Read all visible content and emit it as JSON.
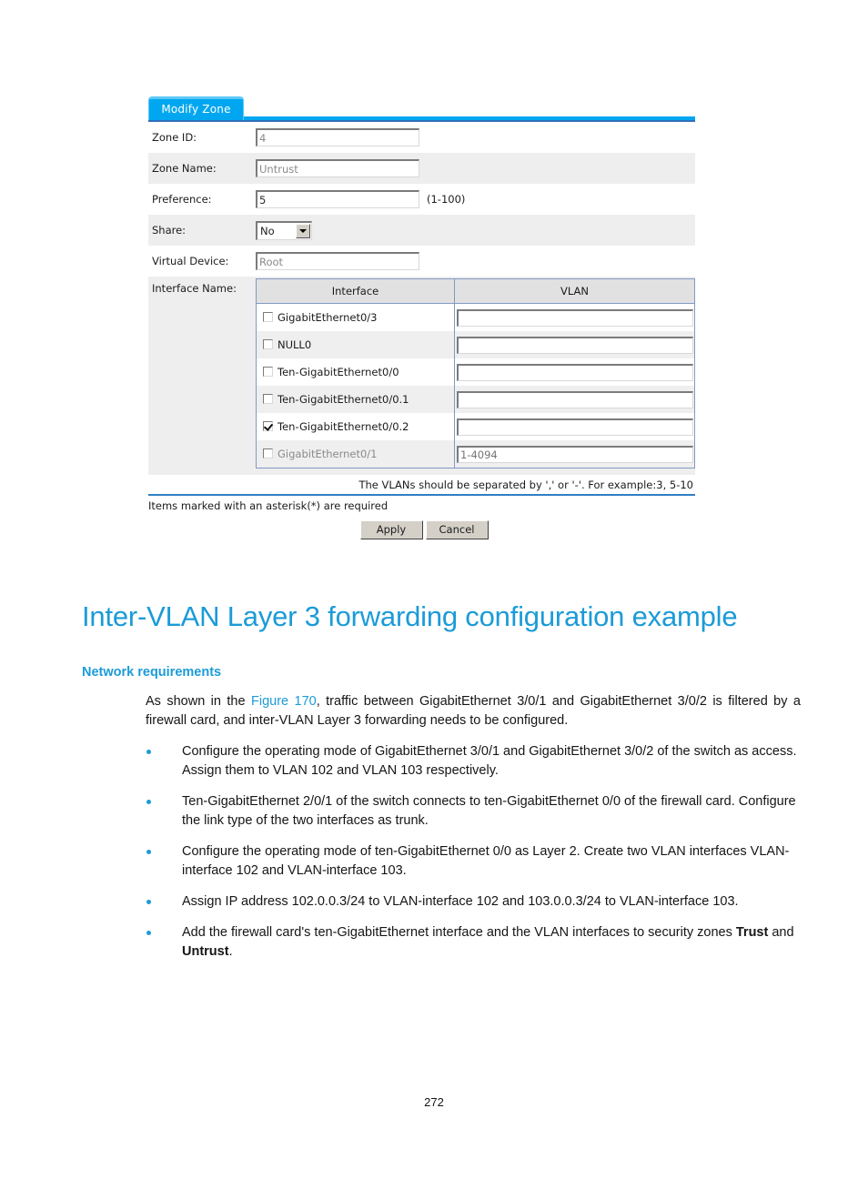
{
  "screenshot": {
    "tab_label": "Modify Zone",
    "fields": [
      {
        "label": "Zone ID:",
        "value": "4",
        "dim": true
      },
      {
        "label": "Zone Name:",
        "value": "Untrust",
        "dim": true
      },
      {
        "label": "Preference:",
        "value": "5",
        "dim": false,
        "hint": "(1-100)"
      },
      {
        "label": "Share:",
        "value": "No",
        "control": "select"
      },
      {
        "label": "Virtual Device:",
        "value": "Root",
        "dim": true
      }
    ],
    "interface_section": {
      "label": "Interface Name:",
      "columns": [
        "Interface",
        "VLAN"
      ],
      "rows": [
        {
          "name": "GigabitEthernet0/3",
          "checked": false,
          "vlan": "",
          "vlan_placeholder": "",
          "dim": false
        },
        {
          "name": "NULL0",
          "checked": false,
          "vlan": "",
          "vlan_placeholder": "",
          "dim": false
        },
        {
          "name": "Ten-GigabitEthernet0/0",
          "checked": false,
          "vlan": "",
          "vlan_placeholder": "",
          "dim": false
        },
        {
          "name": "Ten-GigabitEthernet0/0.1",
          "checked": false,
          "vlan": "",
          "vlan_placeholder": "",
          "dim": false
        },
        {
          "name": "Ten-GigabitEthernet0/0.2",
          "checked": true,
          "vlan": "",
          "vlan_placeholder": "",
          "dim": false
        },
        {
          "name": "GigabitEthernet0/1",
          "checked": false,
          "vlan": "",
          "vlan_placeholder": "1-4094",
          "dim": true
        }
      ],
      "vlan_hint": "The VLANs should be separated by ',' or '-'. For example:3, 5-10"
    },
    "required_note": "Items marked with an asterisk(*) are required",
    "buttons": {
      "apply": "Apply",
      "cancel": "Cancel"
    },
    "colors": {
      "tab_bg": "#00a7f0",
      "tab_top": "#5cc8f7",
      "rule": "#2f7fc4",
      "table_border": "#8099c4"
    }
  },
  "document": {
    "heading": "Inter-VLAN Layer 3 forwarding configuration example",
    "subheading": "Network requirements",
    "intro": {
      "before": "As shown in the ",
      "link": "Figure 170",
      "after": ", traffic between GigabitEthernet 3/0/1 and GigabitEthernet 3/0/2 is filtered by a firewall card, and inter-VLAN Layer 3 forwarding needs to be configured."
    },
    "bullets": [
      {
        "text": "Configure the operating mode of GigabitEthernet 3/0/1 and GigabitEthernet 3/0/2 of the switch as access. Assign them to VLAN 102 and VLAN 103 respectively."
      },
      {
        "text": "Ten-GigabitEthernet 2/0/1 of the switch connects to ten-GigabitEthernet 0/0 of the firewall card. Configure the link type of the two interfaces as trunk."
      },
      {
        "text": "Configure the operating mode of ten-GigabitEthernet 0/0 as Layer 2. Create two VLAN interfaces VLAN-interface 102 and VLAN-interface 103."
      },
      {
        "text": "Assign IP address 102.0.0.3/24 to VLAN-interface 102 and 103.0.0.3/24 to VLAN-interface 103."
      },
      {
        "text": "Add the firewall card's ten-GigabitEthernet interface and the VLAN interfaces to security zones ",
        "bold1": "Trust",
        "mid": " and ",
        "bold2": "Untrust",
        "tail": "."
      }
    ],
    "heading_color": "#1b9bd8",
    "page_number": "272"
  }
}
